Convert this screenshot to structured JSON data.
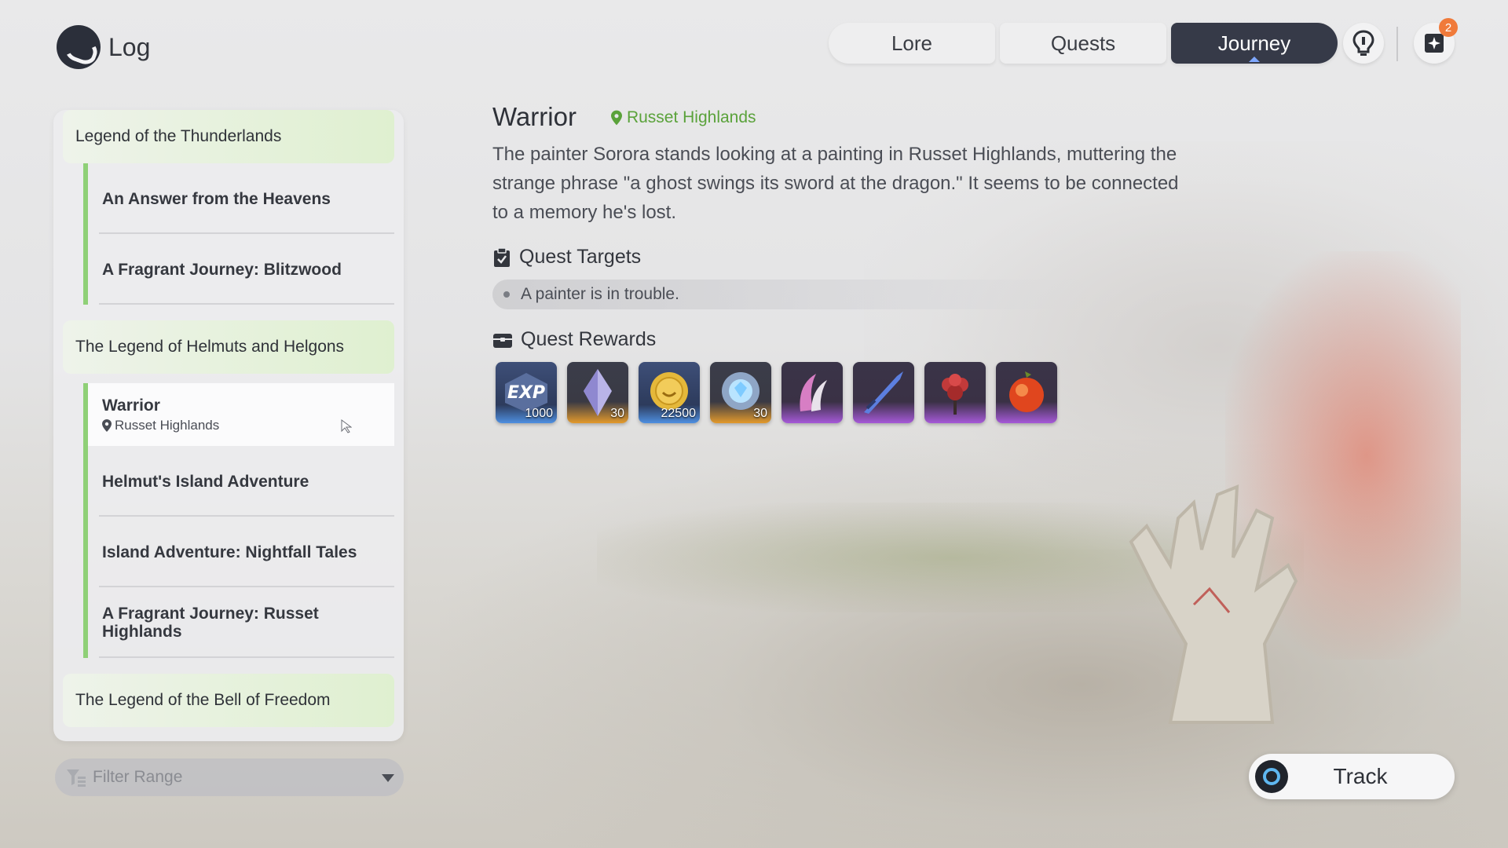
{
  "header": {
    "title": "Log",
    "tabs": [
      {
        "label": "Lore",
        "active": false
      },
      {
        "label": "Quests",
        "active": false
      },
      {
        "label": "Journey",
        "active": true
      }
    ],
    "notification_badge": "2"
  },
  "sidebar": {
    "groups": [
      {
        "title": "Legend of the Thunderlands",
        "quests": [
          {
            "label": "An Answer from the Heavens"
          },
          {
            "label": "A Fragrant Journey: Blitzwood"
          }
        ]
      },
      {
        "title": "The Legend of Helmuts and Helgons",
        "quests": [
          {
            "label": "Warrior",
            "location": "Russet Highlands",
            "selected": true
          },
          {
            "label": "Helmut's Island Adventure"
          },
          {
            "label": "Island Adventure: Nightfall Tales"
          },
          {
            "label": "A Fragrant Journey: Russet Highlands"
          }
        ]
      },
      {
        "title": "The Legend of the Bell of Freedom",
        "quests": []
      }
    ],
    "filter_placeholder": "Filter Range"
  },
  "detail": {
    "title": "Warrior",
    "location": "Russet Highlands",
    "description": "The painter Sorora stands looking at a painting in Russet Highlands, muttering the strange phrase \"a ghost swings its sword at the dragon.\" It seems to be connected to a memory he's lost.",
    "targets_heading": "Quest Targets",
    "targets": [
      "A painter is in trouble."
    ],
    "rewards_heading": "Quest Rewards",
    "rewards": [
      {
        "icon": "exp-icon",
        "count": "1000",
        "rarity": "blue"
      },
      {
        "icon": "crystal-icon",
        "count": "30",
        "rarity": "gold"
      },
      {
        "icon": "coin-icon",
        "count": "22500",
        "rarity": "blue"
      },
      {
        "icon": "orb-icon",
        "count": "30",
        "rarity": "gold"
      },
      {
        "icon": "claw-icon",
        "count": "",
        "rarity": "purple"
      },
      {
        "icon": "sword-icon",
        "count": "",
        "rarity": "purple"
      },
      {
        "icon": "flower-icon",
        "count": "",
        "rarity": "purple"
      },
      {
        "icon": "fruit-icon",
        "count": "",
        "rarity": "purple"
      }
    ]
  },
  "track_button": {
    "label": "Track"
  },
  "colors": {
    "accent_green": "#8fd077",
    "location_green": "#5aa23a",
    "tab_active": "#363a48"
  }
}
